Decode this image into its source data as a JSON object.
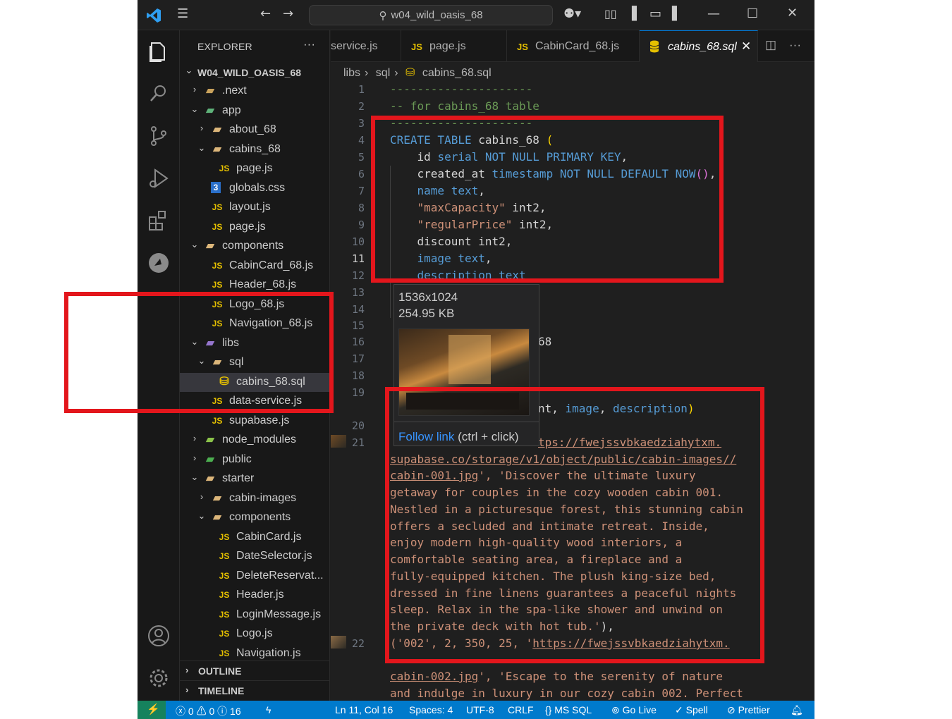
{
  "title": {
    "search_text": "w04_wild_oasis_68"
  },
  "explorer": {
    "header": "EXPLORER",
    "more": "···",
    "root": "W04_WILD_OASIS_68",
    "items": [
      {
        "label": ".next",
        "type": "folder"
      },
      {
        "label": "app",
        "type": "folder"
      },
      {
        "label": "about_68",
        "type": "folder"
      },
      {
        "label": "cabins_68",
        "type": "folder"
      },
      {
        "label": "page.js",
        "type": "js"
      },
      {
        "label": "globals.css",
        "type": "css"
      },
      {
        "label": "layout.js",
        "type": "js"
      },
      {
        "label": "page.js",
        "type": "js"
      },
      {
        "label": "components",
        "type": "folder"
      },
      {
        "label": "CabinCard_68.js",
        "type": "js"
      },
      {
        "label": "Header_68.js",
        "type": "js"
      },
      {
        "label": "Logo_68.js",
        "type": "js"
      },
      {
        "label": "Navigation_68.js",
        "type": "js"
      },
      {
        "label": "libs",
        "type": "folder"
      },
      {
        "label": "sql",
        "type": "folder"
      },
      {
        "label": "cabins_68.sql",
        "type": "sql"
      },
      {
        "label": "data-service.js",
        "type": "js"
      },
      {
        "label": "supabase.js",
        "type": "js"
      },
      {
        "label": "node_modules",
        "type": "folder"
      },
      {
        "label": "public",
        "type": "folder"
      },
      {
        "label": "starter",
        "type": "folder"
      },
      {
        "label": "cabin-images",
        "type": "folder"
      },
      {
        "label": "components",
        "type": "folder"
      },
      {
        "label": "CabinCard.js",
        "type": "js"
      },
      {
        "label": "DateSelector.js",
        "type": "js"
      },
      {
        "label": "DeleteReservat...",
        "type": "js"
      },
      {
        "label": "Header.js",
        "type": "js"
      },
      {
        "label": "LoginMessage.js",
        "type": "js"
      },
      {
        "label": "Logo.js",
        "type": "js"
      },
      {
        "label": "Navigation.js",
        "type": "js"
      }
    ],
    "outline": "OUTLINE",
    "timeline": "TIMELINE"
  },
  "tabs": [
    {
      "label": "service.js",
      "icon": ""
    },
    {
      "label": "page.js",
      "icon": "JS"
    },
    {
      "label": "CabinCard_68.js",
      "icon": "JS"
    },
    {
      "label": "cabins_68.sql",
      "icon": "sql",
      "active": true
    }
  ],
  "breadcrumb": [
    "libs",
    "sql",
    "cabins_68.sql"
  ],
  "line_numbers": [
    "1",
    "2",
    "3",
    "4",
    "5",
    "6",
    "7",
    "8",
    "9",
    "10",
    "11",
    "12",
    "13",
    "14",
    "15",
    "16",
    "17",
    "18",
    "19",
    "20",
    "21",
    "22"
  ],
  "code": {
    "l1": "---------------------",
    "l2": "-- for cabins_68 table",
    "l3": "---------------------",
    "l4a": "CREATE TABLE",
    "l4b": " cabins_68 ",
    "l4c": "(",
    "l5a": "    id ",
    "l5b": "serial NOT NULL PRIMARY KEY",
    "l5c": ",",
    "l6a": "    created_at ",
    "l6b": "timestamp NOT NULL DEFAULT",
    "l6c": " NOW",
    "l6d": "()",
    "l6e": ",",
    "l7a": "    name text",
    "l7b": ",",
    "l8a": "    \"maxCapacity\"",
    "l8b": " int2,",
    "l9a": "    \"regularPrice\"",
    "l9b": " int2,",
    "l10": "    discount int2,",
    "l11a": "    image text",
    "l11b": ",",
    "l12": "    description text",
    "l16": "68",
    "l19b_a": "nt, ",
    "l19b_b": "image",
    "l19b_c": ", ",
    "l19b_d": "description",
    "l19b_e": ")",
    "l21": "tps://fwejssvbkaedziahytxm.",
    "w1": "supabase.co/storage/v1/object/public/cabin-images//",
    "w2a": "cabin-001.jpg",
    "w2b": "', 'Discover the ultimate luxury",
    "w3": "getaway for couples in the cozy wooden cabin 001.",
    "w4": "Nestled in a picturesque forest, this stunning cabin",
    "w5": "offers a secluded and intimate retreat. Inside,",
    "w6": "enjoy modern high-quality wood interiors, a",
    "w7": "comfortable seating area, a fireplace and a",
    "w8": "fully-equipped kitchen. The plush king-size bed,",
    "w9": "dressed in fine linens guarantees a peaceful nights",
    "w10": "sleep. Relax in the spa-like shower and unwind on",
    "w11a": "the private deck with hot tub.'",
    "w11b": "),",
    "l22a": "('002', 2, 350, 25, '",
    "l22b": "https://fwejssvbkaedziahytxm.",
    "w13a": "cabin-002.jpg",
    "w13b": "', 'Escape to the serenity of nature",
    "w14": "and indulge in luxury in our cozy cabin 002. Perfect"
  },
  "hover": {
    "dimensions": "1536x1024",
    "size": "254.95 KB",
    "link": "Follow link",
    "shortcut": " (ctrl + click)"
  },
  "status": {
    "errors": "0",
    "warnings": "0",
    "info": "16",
    "position": "Ln 11, Col 16",
    "spaces": "Spaces: 4",
    "encoding": "UTF-8",
    "eol": "CRLF",
    "language": "MS SQL",
    "golive": "Go Live",
    "spell": "Spell",
    "prettier": "Prettier"
  },
  "colors": {
    "annotation": "#e3161c",
    "accent": "#007acc"
  }
}
